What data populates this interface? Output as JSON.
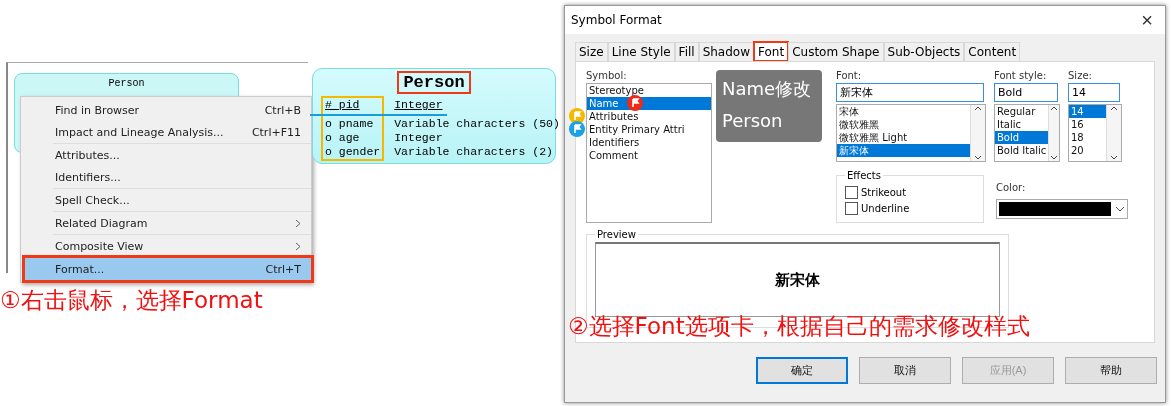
{
  "canvas": {
    "entity_title": "Person"
  },
  "context_menu": {
    "sections": [
      {
        "items": [
          {
            "label": "Find in Browser",
            "shortcut": "Ctrl+B",
            "submenu": false,
            "selected": false,
            "highlighted": false
          },
          {
            "label": "Impact and Lineage Analysis...",
            "shortcut": "Ctrl+F11",
            "submenu": false,
            "selected": false,
            "highlighted": false
          }
        ]
      },
      {
        "items": [
          {
            "label": "Attributes...",
            "submenu": false,
            "selected": false,
            "highlighted": false
          },
          {
            "label": "Identifiers...",
            "submenu": false,
            "selected": false,
            "highlighted": false
          }
        ]
      },
      {
        "items": [
          {
            "label": "Spell Check...",
            "submenu": false,
            "selected": false,
            "highlighted": false
          }
        ]
      },
      {
        "items": [
          {
            "label": "Related Diagram",
            "submenu": true,
            "selected": false,
            "highlighted": false
          }
        ]
      },
      {
        "items": [
          {
            "label": "Composite View",
            "submenu": true,
            "selected": false,
            "highlighted": false
          }
        ]
      },
      {
        "items": [
          {
            "label": "Format...",
            "shortcut": "Ctrl+T",
            "submenu": false,
            "selected": true,
            "highlighted": true
          }
        ]
      }
    ]
  },
  "step1_note": "①右击鼠标，选择Format",
  "entity": {
    "title": "Person",
    "title_highlighted": true,
    "names_highlighted": true,
    "attributes": [
      {
        "marker": "#",
        "name": "pid",
        "type": "Integer",
        "identifier": true
      },
      {
        "marker": "o",
        "name": "pname",
        "type": "Variable characters (50)",
        "identifier": false
      },
      {
        "marker": "o",
        "name": "age",
        "type": "Integer",
        "identifier": false
      },
      {
        "marker": "o",
        "name": "gender",
        "type": "Variable characters (2)",
        "identifier": false
      }
    ]
  },
  "dialog": {
    "title": "Symbol Format",
    "close": "×",
    "tabs": [
      {
        "label": "Size",
        "selected": false,
        "highlighted": false
      },
      {
        "label": "Line Style",
        "selected": false,
        "highlighted": false
      },
      {
        "label": "Fill",
        "selected": false,
        "highlighted": false
      },
      {
        "label": "Shadow",
        "selected": false,
        "highlighted": false
      },
      {
        "label": "Font",
        "selected": true,
        "highlighted": true
      },
      {
        "label": "Custom Shape",
        "selected": false,
        "highlighted": false
      },
      {
        "label": "Sub-Objects",
        "selected": false,
        "highlighted": false
      },
      {
        "label": "Content",
        "selected": false,
        "highlighted": false
      }
    ],
    "symbol_label": "Symbol:",
    "symbols": [
      {
        "label": "Stereotype",
        "selected": false
      },
      {
        "label": "Name",
        "selected": true,
        "color": "#ee2a1b"
      },
      {
        "label": "Attributes",
        "selected": false,
        "color": "#f5b800"
      },
      {
        "label": "Entity Primary Attri",
        "selected": false,
        "color": "#1ca0e6"
      },
      {
        "label": "Identifiers",
        "selected": false
      },
      {
        "label": "Comment",
        "selected": false
      }
    ],
    "font_label": "Font:",
    "font_value": "新宋体",
    "fonts": [
      {
        "label": "宋体",
        "selected": false
      },
      {
        "label": "微软雅黑",
        "selected": false
      },
      {
        "label": "微软雅黑 Light",
        "selected": false
      },
      {
        "label": "新宋体",
        "selected": true
      }
    ],
    "style_label": "Font style:",
    "style_value": "Bold",
    "styles": [
      {
        "label": "Regular",
        "selected": false
      },
      {
        "label": "Italic",
        "selected": false
      },
      {
        "label": "Bold",
        "selected": true
      },
      {
        "label": "Bold Italic",
        "selected": false
      }
    ],
    "size_label": "Size:",
    "size_value": "14",
    "sizes": [
      {
        "label": "14",
        "selected": true
      },
      {
        "label": "16",
        "selected": false
      },
      {
        "label": "18",
        "selected": false
      },
      {
        "label": "20",
        "selected": false
      }
    ],
    "effects_title": "Effects",
    "effects": [
      {
        "label": "Strikeout",
        "checked": false
      },
      {
        "label": "Underline",
        "checked": false
      }
    ],
    "color_label": "Color:",
    "color": "#000000",
    "preview_label": "Preview",
    "preview_text": "新宋体",
    "buttons": [
      {
        "label": "确定",
        "default": true,
        "disabled": false
      },
      {
        "label": "取消",
        "default": false,
        "disabled": false
      },
      {
        "label": "应用(A)",
        "default": false,
        "disabled": true
      },
      {
        "label": "帮助",
        "default": false,
        "disabled": false
      }
    ]
  },
  "tooltip": {
    "lines": [
      "Name修改",
      "Person"
    ]
  },
  "step2_note": "②选择Font选项卡，根据自己的需求修改样式"
}
